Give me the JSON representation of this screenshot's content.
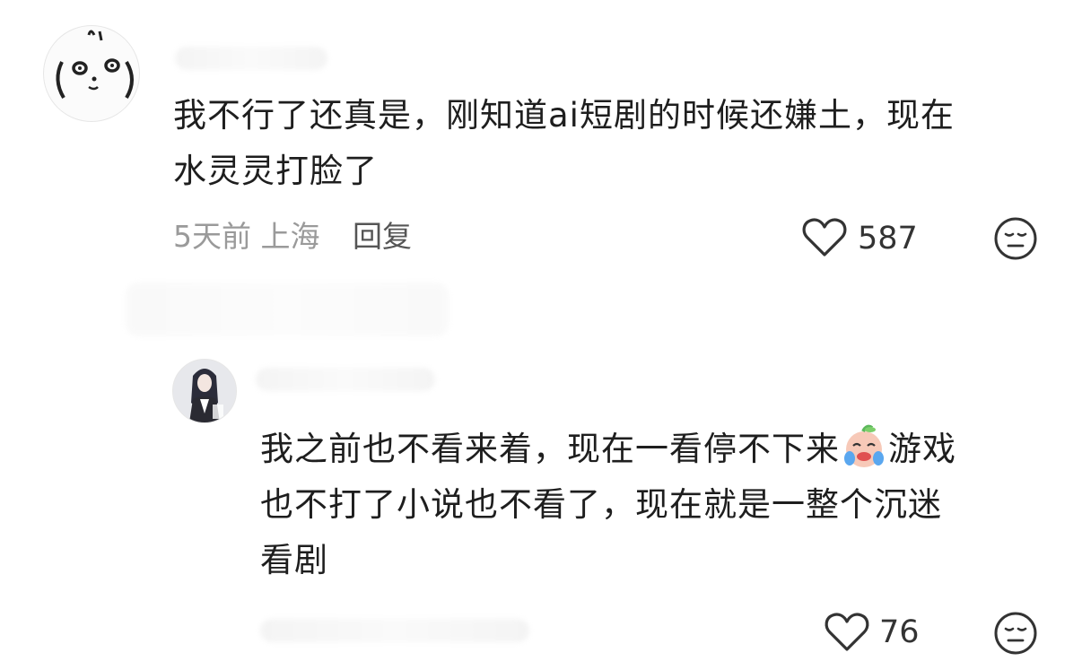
{
  "comment1": {
    "text_line1": "我不行了还真是，刚知道ai短剧的时候还嫌土，现在",
    "text_line2": "水灵灵打脸了",
    "time": "5天前",
    "location": "上海",
    "reply_label": "回复",
    "likes": "587"
  },
  "reply1": {
    "text_line1_before_emoji": "我之前也不看来着，现在一看停不下来",
    "text_line1_after_emoji": "游戏",
    "text_line2": "也不打了小说也不看了，现在就是一整个沉迷",
    "text_line3": "看剧",
    "likes": "76"
  },
  "icons": {
    "like": "heart-outline-icon",
    "dislike": "meh-face-icon",
    "emoji": "crying-face-emoji"
  },
  "colors": {
    "text": "#1e1e1e",
    "meta": "#9a9a9a",
    "icon": "#333333"
  }
}
